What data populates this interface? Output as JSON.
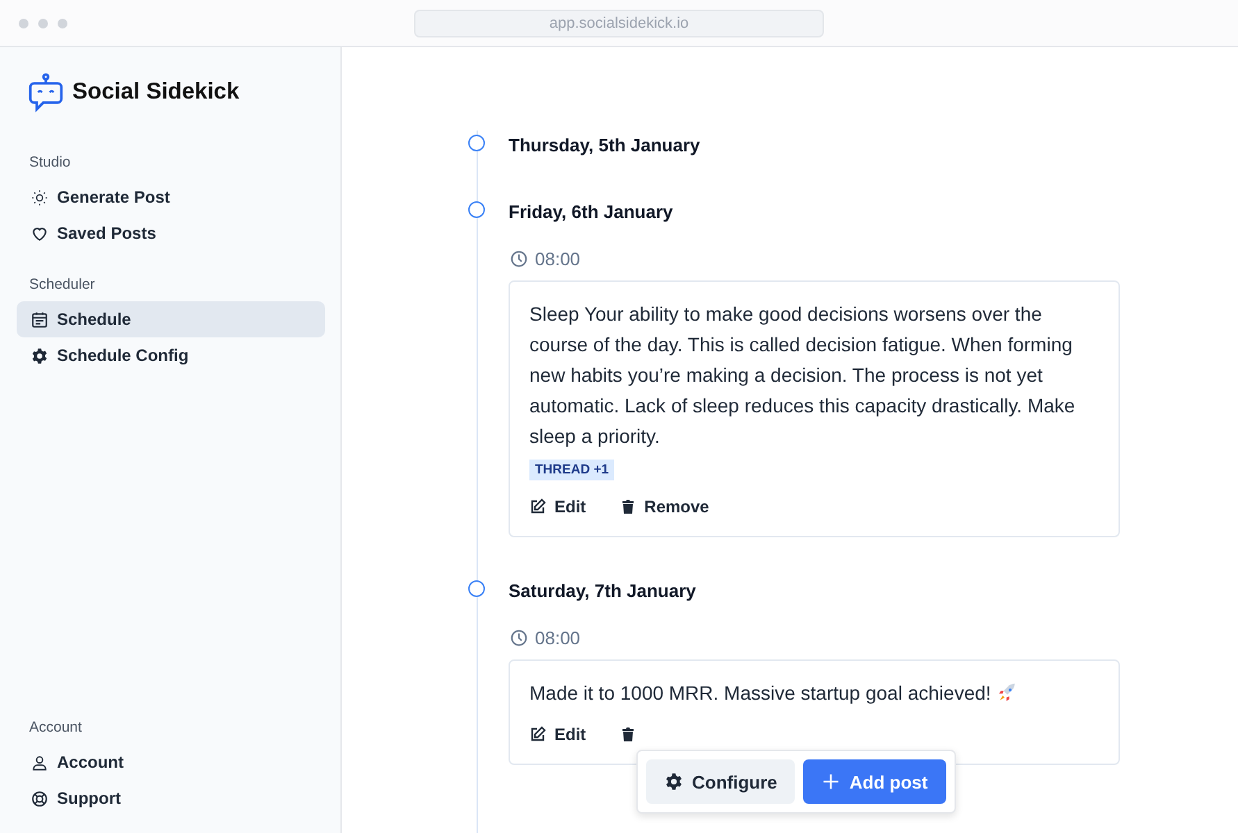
{
  "browser": {
    "url": "app.socialsidekick.io"
  },
  "brand": {
    "name": "Social Sidekick"
  },
  "sidebar": {
    "sections": [
      {
        "title": "Studio",
        "items": [
          {
            "label": "Generate Post",
            "kind": "sun",
            "selected": false
          },
          {
            "label": "Saved Posts",
            "kind": "heart",
            "selected": false
          }
        ]
      },
      {
        "title": "Scheduler",
        "items": [
          {
            "label": "Schedule",
            "kind": "calendar",
            "selected": true
          },
          {
            "label": "Schedule Config",
            "kind": "gear",
            "selected": false
          }
        ]
      }
    ],
    "bottom_section": {
      "title": "Account",
      "items": [
        {
          "label": "Account",
          "kind": "user",
          "selected": false
        },
        {
          "label": "Support",
          "kind": "lifebuoy",
          "selected": false
        }
      ]
    }
  },
  "timeline": [
    {
      "date": "Thursday, 5th January"
    },
    {
      "date": "Friday, 6th January",
      "posts": [
        {
          "time": "08:00",
          "text": "Sleep Your ability to make good decisions worsens over the course of the day. This is called decision fatigue. When forming new habits you’re making a decision. The process is not yet automatic. Lack of sleep reduces this capacity drastically. Make sleep a priority.",
          "rocket": false,
          "badge": "THREAD +1",
          "actions": [
            {
              "kind": "edit",
              "label": "Edit"
            },
            {
              "kind": "remove",
              "label": "Remove"
            }
          ]
        }
      ]
    },
    {
      "date": "Saturday, 7th January",
      "posts": [
        {
          "time": "08:00",
          "text": "Made it to 1000 MRR. Massive startup goal achieved!",
          "rocket": true,
          "actions": [
            {
              "kind": "edit",
              "label": "Edit"
            },
            {
              "kind": "remove"
            }
          ]
        }
      ]
    }
  ],
  "floating_bar": {
    "buttons": [
      {
        "kind": "configure",
        "label": "Configure"
      },
      {
        "kind": "add",
        "label": "Add post"
      }
    ]
  }
}
